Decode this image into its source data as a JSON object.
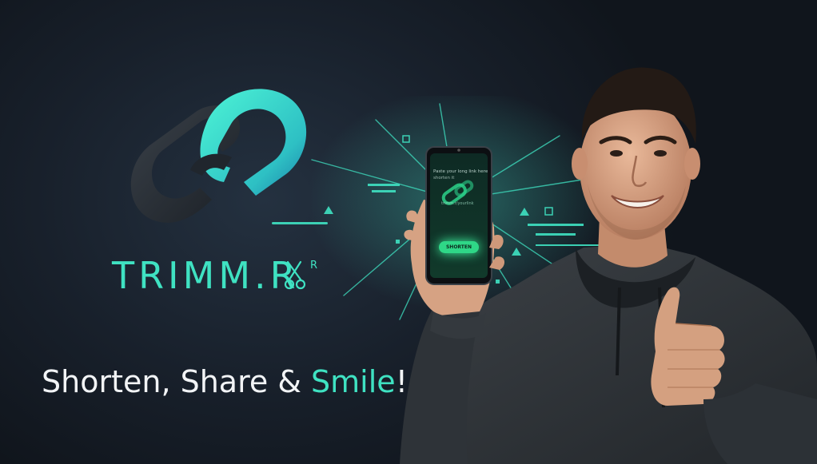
{
  "brand": {
    "name": "TRIMM.R",
    "superscript": "R"
  },
  "tagline": {
    "main": "Shorten, Share & ",
    "accent": "Smile",
    "end": "!"
  },
  "phone": {
    "screen_line1": "Paste your long link here",
    "screen_line2": "shorten it",
    "field_text": "trimm.r/yourlink",
    "button_label": "SHORTEN"
  },
  "colors": {
    "accent": "#3fe2c2",
    "background": "#161d26",
    "button_glow": "#2fd787"
  },
  "icons": [
    "chain-link-icon",
    "scissors-icon",
    "thumbs-up"
  ]
}
